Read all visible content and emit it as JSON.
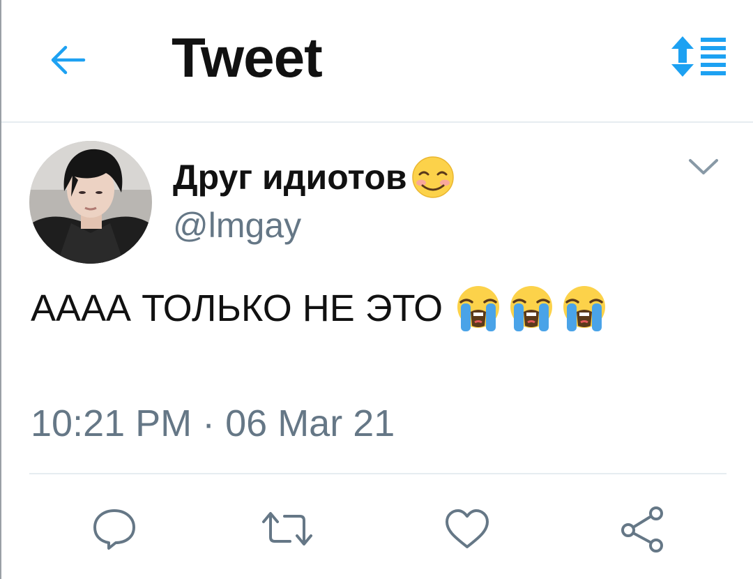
{
  "header": {
    "title": "Tweet",
    "back_icon": "arrow-left-icon",
    "sort_icon": "sort-order-icon",
    "accent_color": "#1da1f2"
  },
  "tweet": {
    "author": {
      "display_name": "Друг идиотов",
      "name_emoji": "smiling-face-emoji",
      "handle": "@lmgay"
    },
    "text": "АААА ТОЛЬКО НЕ ЭТО",
    "text_emojis": [
      "loudly-crying-face-emoji",
      "loudly-crying-face-emoji",
      "loudly-crying-face-emoji"
    ],
    "timestamp": "10:21 PM · 06 Mar 21",
    "more_icon": "chevron-down-icon"
  },
  "actions": [
    {
      "name": "reply",
      "icon": "reply-icon"
    },
    {
      "name": "retweet",
      "icon": "retweet-icon"
    },
    {
      "name": "like",
      "icon": "heart-icon"
    },
    {
      "name": "share",
      "icon": "share-icon"
    }
  ],
  "colors": {
    "text_primary": "#111111",
    "text_secondary": "#657786",
    "divider": "#e6ecf0"
  }
}
